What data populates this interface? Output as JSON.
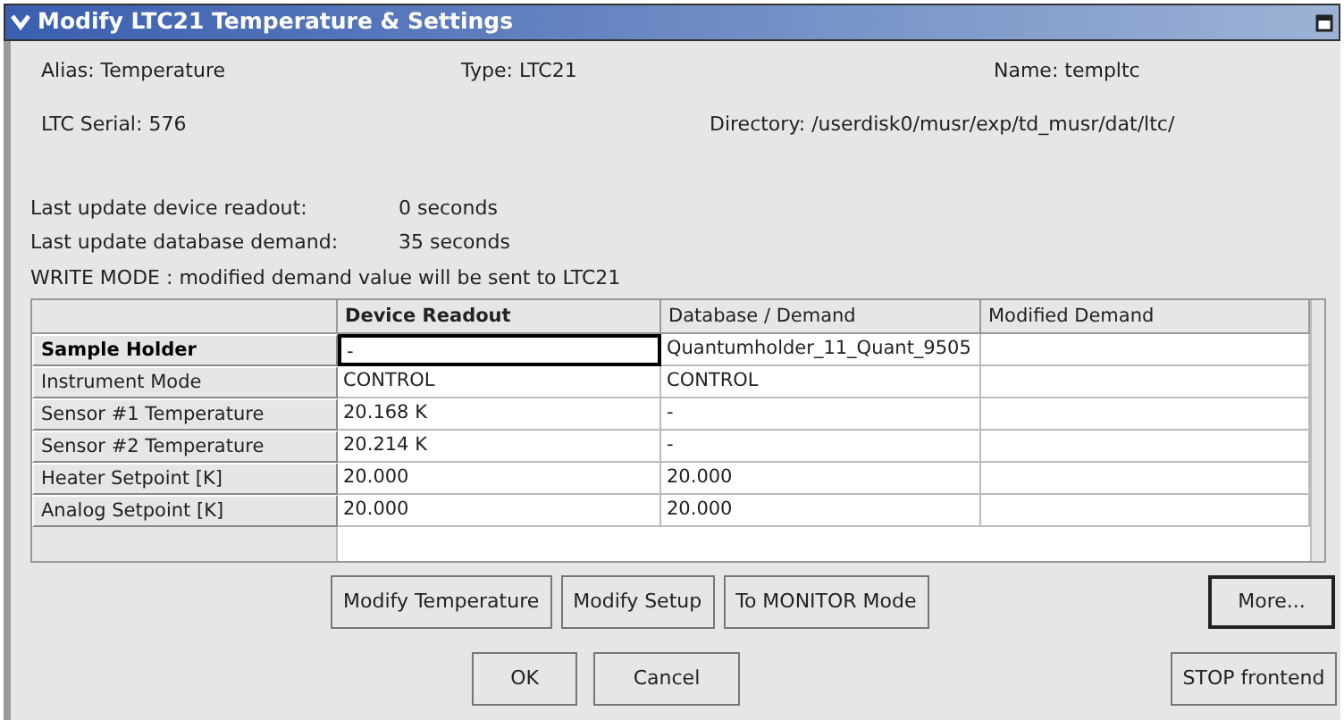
{
  "window": {
    "title": "Modify LTC21 Temperature & Settings"
  },
  "info": {
    "alias": "Alias: Temperature",
    "type": "Type: LTC21",
    "name": "Name: templtc",
    "serial": "LTC Serial: 576",
    "directory": "Directory: /userdisk0/musr/exp/td_musr/dat/ltc/"
  },
  "updates": [
    {
      "label": "Last update device readout:",
      "value": "0 seconds"
    },
    {
      "label": "Last update database demand:",
      "value": "35 seconds"
    }
  ],
  "mode_message": "WRITE MODE : modified demand value will be sent to LTC21",
  "table": {
    "columns": [
      {
        "label": "Device Readout",
        "bold": true
      },
      {
        "label": "Database / Demand",
        "bold": false
      },
      {
        "label": "Modified Demand",
        "bold": false
      }
    ],
    "rows": [
      {
        "label": "Sample Holder",
        "selected": true,
        "cells": [
          "-",
          "Quantumholder_11_Quant_9505",
          ""
        ]
      },
      {
        "label": "Instrument Mode",
        "selected": false,
        "cells": [
          "CONTROL",
          "CONTROL",
          ""
        ]
      },
      {
        "label": "Sensor #1 Temperature",
        "selected": false,
        "cells": [
          "20.168 K",
          "-",
          ""
        ]
      },
      {
        "label": "Sensor #2 Temperature",
        "selected": false,
        "cells": [
          "20.214 K",
          "-",
          ""
        ]
      },
      {
        "label": "Heater Setpoint [K]",
        "selected": false,
        "cells": [
          "20.000",
          "20.000",
          ""
        ]
      },
      {
        "label": "Analog Setpoint [K]",
        "selected": false,
        "cells": [
          "20.000",
          "20.000",
          ""
        ]
      }
    ]
  },
  "action_buttons": [
    {
      "label": "Modify Temperature",
      "default": false
    },
    {
      "label": "Modify Setup",
      "default": false
    },
    {
      "label": "To MONITOR Mode",
      "default": false
    }
  ],
  "more_button": {
    "label": "More...",
    "default": true
  },
  "dialog_buttons": [
    {
      "label": "OK"
    },
    {
      "label": "Cancel"
    }
  ],
  "stop_button": {
    "label": "STOP frontend"
  }
}
